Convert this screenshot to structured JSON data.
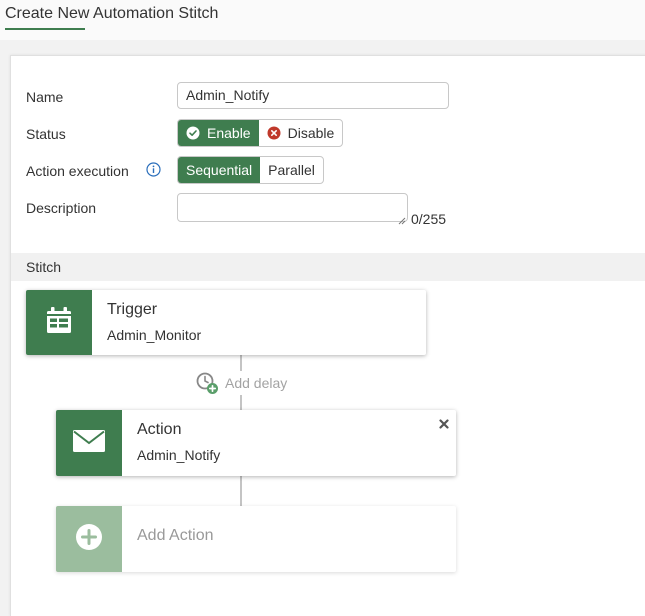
{
  "page": {
    "title": "Create New Automation Stitch"
  },
  "form": {
    "name": {
      "label": "Name",
      "value": "Admin_Notify"
    },
    "status": {
      "label": "Status",
      "options": [
        "Enable",
        "Disable"
      ],
      "selected": "Enable",
      "icons": [
        "check-circle-icon",
        "x-circle-icon"
      ]
    },
    "action_execution": {
      "label": "Action execution",
      "options": [
        "Sequential",
        "Parallel"
      ],
      "selected": "Sequential",
      "info_icon": "info-icon"
    },
    "description": {
      "label": "Description",
      "value": "",
      "char_count": "0/255"
    }
  },
  "stitch": {
    "section_title": "Stitch",
    "trigger": {
      "title": "Trigger",
      "value": "Admin_Monitor",
      "icon": "calendar-icon"
    },
    "add_delay": {
      "label": "Add delay",
      "icon": "clock-plus-icon"
    },
    "action": {
      "title": "Action",
      "value": "Admin_Notify",
      "icon": "envelope-icon",
      "remove_icon": "close-icon"
    },
    "add_action": {
      "label": "Add Action",
      "icon": "plus-circle-icon"
    }
  },
  "colors": {
    "accent": "#3f7d4f",
    "accent_light": "#9bbd9e",
    "error": "#c0392b",
    "muted_text": "#a3a3a3"
  }
}
